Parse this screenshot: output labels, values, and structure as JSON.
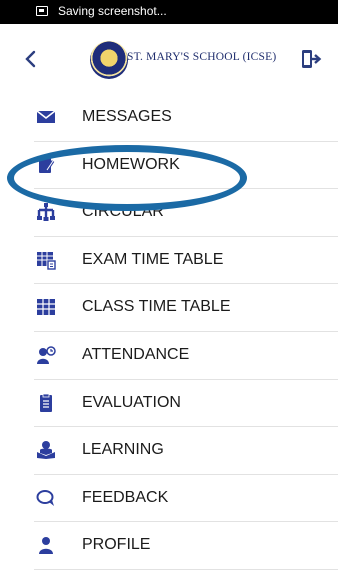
{
  "status_bar": {
    "text": "Saving screenshot..."
  },
  "header": {
    "school_name": "ST. MARY'S SCHOOL (ICSE)"
  },
  "menu": {
    "items": [
      {
        "label": "MESSAGES"
      },
      {
        "label": "HOMEWORK"
      },
      {
        "label": "CIRCULAR"
      },
      {
        "label": "EXAM TIME TABLE"
      },
      {
        "label": "CLASS TIME TABLE"
      },
      {
        "label": "ATTENDANCE"
      },
      {
        "label": "EVALUATION"
      },
      {
        "label": "LEARNING"
      },
      {
        "label": "FEEDBACK"
      },
      {
        "label": "PROFILE"
      }
    ]
  },
  "colors": {
    "accent": "#2c3e7f",
    "highlight_ring": "#1b6aa5",
    "status_bar": "#000000"
  }
}
